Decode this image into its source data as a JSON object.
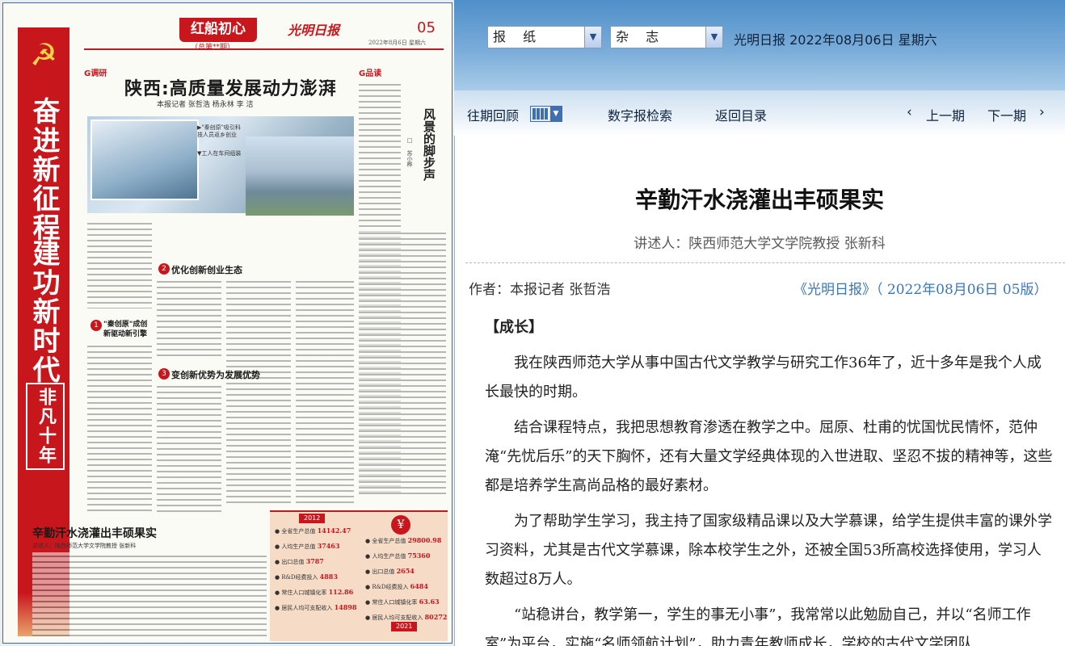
{
  "paper": {
    "banner": {
      "slogan1": "奋进新征程",
      "slogan2": "建功新时代",
      "slogan3": "非凡十年"
    },
    "header": {
      "section_title": "红船初心",
      "section_sub": "（总第**期）",
      "logo": "光明日报",
      "page_no": "05",
      "meta": "2022年8月6日  星期六"
    },
    "story1": {
      "tag": "G调研",
      "headline": "陕西:高质量发展动力澎湃",
      "byline": "本报记者  张哲浩  杨永林  李  洁",
      "caption1": "▶\"秦创原\"吸引科技人员返乡创业",
      "caption2": "▼工人在车间组装",
      "sub1": "\"秦创原\"成创新驱动新引擎",
      "sub2": "优化创新创业生态",
      "sub3": "变创新优势为发展优势"
    },
    "column": {
      "tag": "G品读",
      "title": "风景的脚步声",
      "author": "□ 苏小桦"
    },
    "story2": {
      "tag": "G成长",
      "headline": "辛勤汗水浇灌出丰硕果实",
      "byline": "讲述人：陕西师范大学文学院教授  张新科"
    },
    "infographic": {
      "year_a": "2012",
      "year_b": "2021",
      "rows_a": [
        {
          "label": "全省生产总值",
          "value": "14142.47"
        },
        {
          "label": "人均生产总值",
          "value": "37463"
        },
        {
          "label": "出口总值",
          "value": "3787"
        },
        {
          "label": "R&D经费投入",
          "value": "4883"
        },
        {
          "label": "常住人口城镇化率",
          "value": "112.86"
        },
        {
          "label": "居民人均可支配收入",
          "value": "14898"
        }
      ],
      "rows_b": [
        {
          "label": "全省生产总值",
          "value": "29800.98"
        },
        {
          "label": "人均生产总值",
          "value": "75360"
        },
        {
          "label": "出口总值",
          "value": "2654"
        },
        {
          "label": "R&D经费投入",
          "value": "6484"
        },
        {
          "label": "常住人口城镇化率",
          "value": "63.63"
        },
        {
          "label": "居民人均可支配收入",
          "value": "80272"
        }
      ]
    }
  },
  "topbar": {
    "select_newspaper": "报 纸",
    "select_magazine": "杂 志",
    "pub_info": "光明日报  2022年08月06日  星期六"
  },
  "toolbar": {
    "past_issues": "往期回顾",
    "search": "数字报检索",
    "back_to_index": "返回目录",
    "prev_issue": "上一期",
    "next_issue": "下一期"
  },
  "article": {
    "title": "辛勤汗水浇灌出丰硕果实",
    "speaker": "讲述人：陕西师范大学文学院教授 张新科",
    "author": "作者：本报记者 张哲浩",
    "source": "《光明日报》（ 2022年08月06日   05版）",
    "section_label": "【成长】",
    "paragraphs": [
      "我在陕西师范大学从事中国古代文学教学与研究工作36年了，近十多年是我个人成长最快的时期。",
      "结合课程特点，我把思想教育渗透在教学之中。屈原、杜甫的忧国忧民情怀，范仲淹“先忧后乐”的天下胸怀，还有大量文学经典体现的入世进取、坚忍不拔的精神等，这些都是培养学生高尚品格的最好素材。",
      "为了帮助学生学习，我主持了国家级精品课以及大学慕课，给学生提供丰富的课外学习资料，尤其是古代文学慕课，除本校学生之外，还被全国53所高校选择使用，学习人数超过8万人。",
      "“站稳讲台，教学第一，学生的事无小事”，我常常以此勉励自己，并以“名师工作室”为平台，实施“名师领航计划”，助力青年教师成长，学校的古代文学团队"
    ]
  }
}
